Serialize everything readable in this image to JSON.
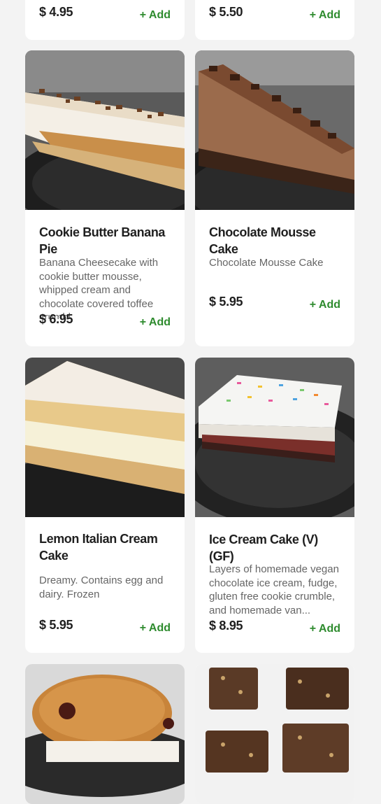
{
  "colors": {
    "background": "#f3f3f3",
    "card": "#ffffff",
    "accent_green": "#2e8b2e",
    "title_text": "#1f1f1f",
    "desc_text": "#666666"
  },
  "top_row": [
    {
      "price": "$ 4.95",
      "add_label": "+ Add"
    },
    {
      "price": "$ 5.50",
      "add_label": "+ Add"
    }
  ],
  "items": [
    {
      "title": "Cookie Butter Banana Pie",
      "description": "Banana Cheesecake with cookie butter mousse, whipped cream and chocolate covered toffee crumbl...",
      "price": "$ 6.95",
      "add_label": "+ Add",
      "image": "cookie-butter-banana-pie-photo"
    },
    {
      "title": "Chocolate Mousse Cake",
      "description": "Chocolate Mousse Cake",
      "price": "$ 5.95",
      "add_label": "+ Add",
      "image": "chocolate-mousse-cake-photo"
    },
    {
      "title": "Lemon Italian Cream Cake",
      "description": "Dreamy. Contains egg and dairy. Frozen",
      "price": "$ 5.95",
      "add_label": "+ Add",
      "image": "lemon-italian-cream-cake-photo"
    },
    {
      "title": "Ice Cream Cake (V)(GF)",
      "description": "Layers of homemade vegan chocolate ice cream, fudge, gluten free cookie crumble, and homemade van...",
      "price": "$ 8.95",
      "add_label": "+ Add",
      "image": "ice-cream-cake-photo"
    }
  ],
  "bottom_row": [
    {
      "image": "cookie-sandwich-photo"
    },
    {
      "image": "brownie-squares-photo"
    }
  ]
}
